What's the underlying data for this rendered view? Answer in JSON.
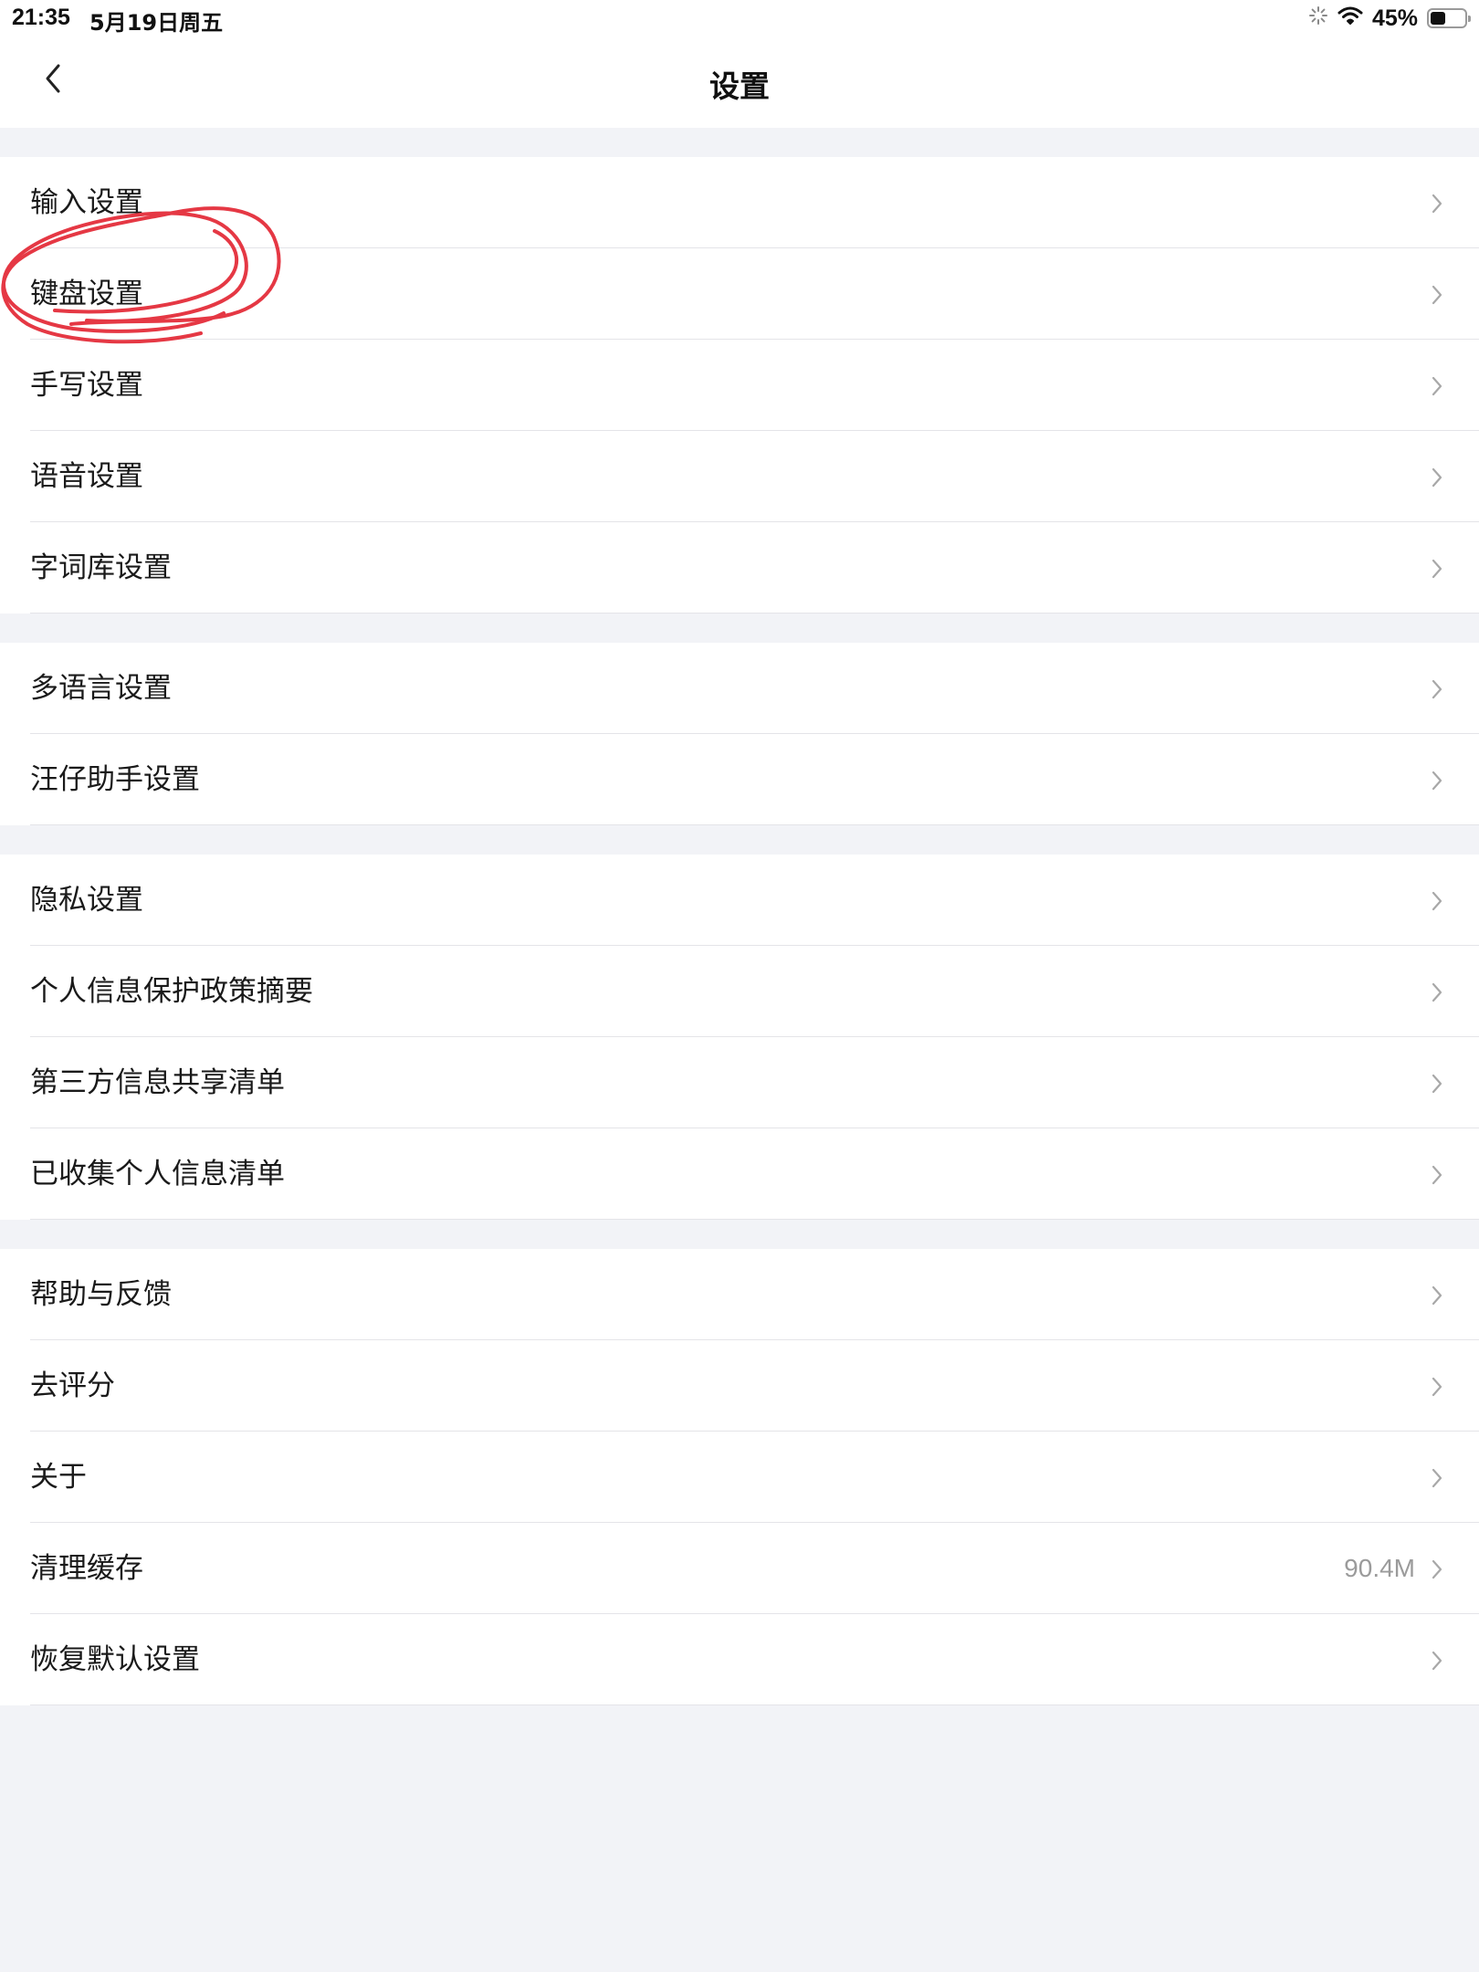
{
  "status_bar": {
    "time": "21:35",
    "date": "5月19日周五",
    "battery_text": "45%",
    "battery_level": 0.45
  },
  "header": {
    "title": "设置",
    "back_icon": "chevron-left-icon"
  },
  "groups": [
    {
      "items": [
        {
          "label": "输入设置"
        },
        {
          "label": "键盘设置"
        },
        {
          "label": "手写设置"
        },
        {
          "label": "语音设置"
        },
        {
          "label": "字词库设置"
        }
      ]
    },
    {
      "items": [
        {
          "label": "多语言设置"
        },
        {
          "label": "汪仔助手设置"
        }
      ]
    },
    {
      "items": [
        {
          "label": "隐私设置"
        },
        {
          "label": "个人信息保护政策摘要"
        },
        {
          "label": "第三方信息共享清单"
        },
        {
          "label": "已收集个人信息清单"
        }
      ]
    },
    {
      "items": [
        {
          "label": "帮助与反馈"
        },
        {
          "label": "去评分"
        },
        {
          "label": "关于"
        },
        {
          "label": "清理缓存",
          "value": "90.4M"
        },
        {
          "label": "恢复默认设置"
        }
      ]
    }
  ],
  "annotation": {
    "color": "#e53844",
    "target": "键盘设置"
  },
  "colors": {
    "background": "#f2f3f7",
    "row_background": "#ffffff",
    "divider": "#e4e4e8",
    "value_text": "#9b9b9b",
    "chevron": "#a8a8a8"
  }
}
